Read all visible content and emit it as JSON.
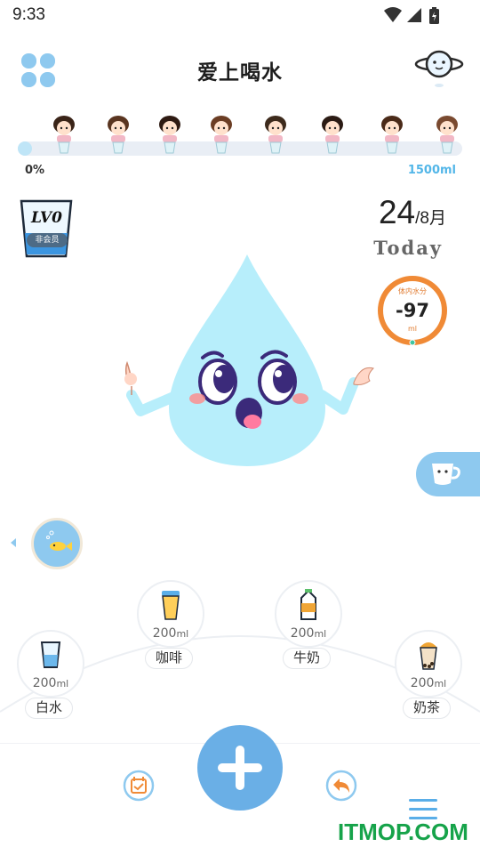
{
  "status_bar": {
    "time": "9:33",
    "icons": [
      "wifi-icon",
      "signal-icon",
      "battery-charging-icon"
    ]
  },
  "header": {
    "title": "爱上喝水",
    "menu_icon": "grid-menu-icon",
    "profile_icon": "planet-icon"
  },
  "progress": {
    "min_label": "0%",
    "max_label": "1500ml",
    "fill_fraction": 0.0,
    "avatars": [
      "girl-1",
      "girl-2",
      "girl-3",
      "girl-4",
      "girl-5",
      "girl-6",
      "girl-7",
      "girl-8"
    ]
  },
  "membership": {
    "badge_text": "LV0",
    "status": "非会员"
  },
  "date": {
    "day": "24",
    "month": "/8月",
    "label": "Today"
  },
  "body_water": {
    "label": "体内水分",
    "value": "-97",
    "unit": "ml"
  },
  "drinks": [
    {
      "amount": "200",
      "unit": "ml",
      "label": "白水",
      "icon": "water-glass-icon"
    },
    {
      "amount": "200",
      "unit": "ml",
      "label": "咖啡",
      "icon": "coffee-cup-icon"
    },
    {
      "amount": "200",
      "unit": "ml",
      "label": "牛奶",
      "icon": "milk-carton-icon"
    },
    {
      "amount": "200",
      "unit": "ml",
      "label": "奶茶",
      "icon": "milk-tea-icon"
    }
  ],
  "bottom_nav": {
    "calendar_icon": "calendar-check-icon",
    "add_icon": "plus-icon",
    "back_icon": "undo-icon",
    "menu_icon": "list-menu-icon"
  },
  "watermark": "ITMOP.COM",
  "colors": {
    "accent": "#8ec9ef",
    "add_button": "#6aafe6",
    "ring": "#f08a36",
    "max_label": "#52b6e8",
    "drop": "#b7eefb"
  }
}
